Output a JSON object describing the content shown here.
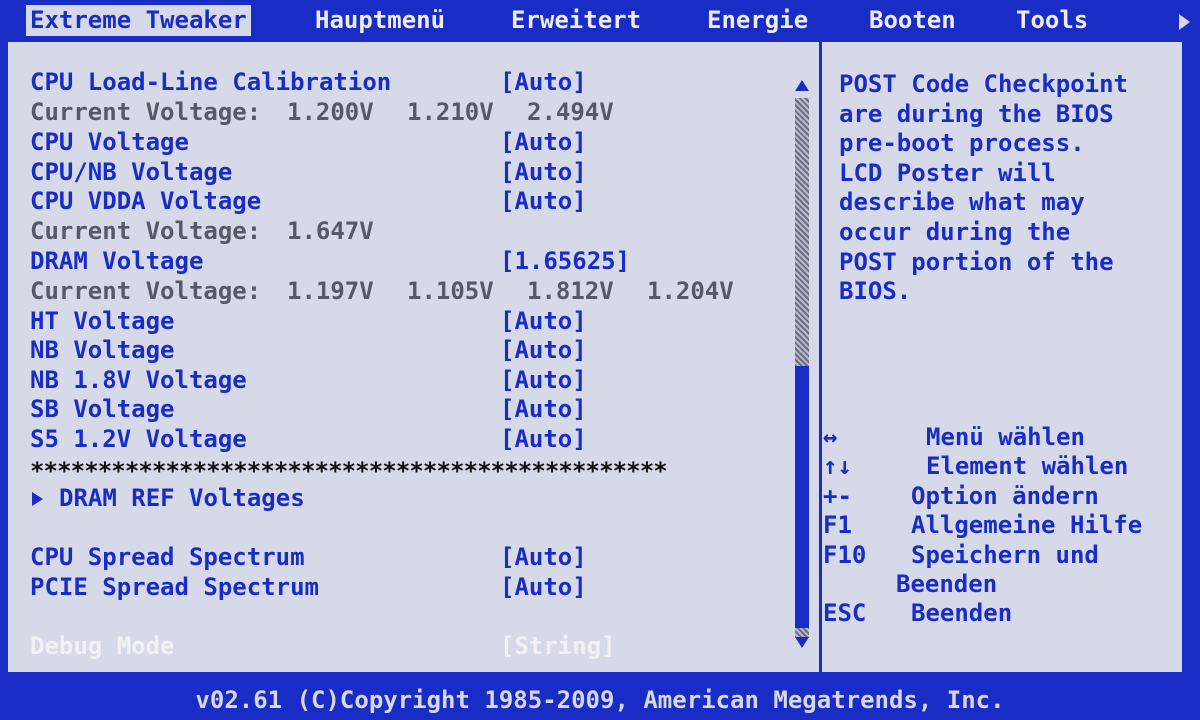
{
  "menu": {
    "tabs": [
      "Extreme Tweaker",
      "Hauptmenü",
      "Erweitert",
      "Energie",
      "Booten",
      "Tools"
    ]
  },
  "settings": [
    {
      "label": "CPU Load-Line Calibration",
      "value": "[Auto]"
    },
    {
      "label": "Current Voltage:",
      "readings": [
        "1.200V",
        "1.210V",
        "2.494V"
      ]
    },
    {
      "label": "CPU Voltage",
      "value": "[Auto]"
    },
    {
      "label": "CPU/NB Voltage",
      "value": "[Auto]"
    },
    {
      "label": "CPU VDDA Voltage",
      "value": "[Auto]"
    },
    {
      "label": "Current Voltage:",
      "readings": [
        "1.647V"
      ]
    },
    {
      "label": "DRAM Voltage",
      "value": "[1.65625]"
    },
    {
      "label": "Current Voltage:",
      "readings": [
        "1.197V",
        "1.105V",
        "1.812V",
        "1.204V"
      ]
    },
    {
      "label": "HT Voltage",
      "value": "[Auto]"
    },
    {
      "label": "NB Voltage",
      "value": "[Auto]"
    },
    {
      "label": "NB 1.8V Voltage",
      "value": "[Auto]"
    },
    {
      "label": "SB Voltage",
      "value": "[Auto]"
    },
    {
      "label": "S5 1.2V Voltage",
      "value": "[Auto]"
    }
  ],
  "separator": "***********************************************",
  "submenu": {
    "label": "DRAM REF Voltages"
  },
  "spread": [
    {
      "label": "CPU Spread Spectrum",
      "value": "[Auto]"
    },
    {
      "label": "PCIE Spread Spectrum",
      "value": "[Auto]"
    }
  ],
  "debug": {
    "label": "Debug Mode",
    "value": "[String]"
  },
  "help_lines": [
    "POST Code Checkpoint",
    "are during the BIOS",
    "pre-boot process.",
    "LCD Poster will",
    "describe what may",
    "occur during the",
    "POST portion of the",
    "BIOS."
  ],
  "keys": [
    {
      "key": "↔",
      "desc": "Menü wählen"
    },
    {
      "key": "↑↓",
      "desc": "Element wählen"
    },
    {
      "key": "+-",
      "desc": "Option ändern"
    },
    {
      "key": "F1",
      "desc": "Allgemeine Hilfe"
    },
    {
      "key": "F10",
      "desc": "Speichern und"
    },
    {
      "key": "",
      "desc": "Beenden"
    },
    {
      "key": "ESC",
      "desc": "Beenden"
    }
  ],
  "footer": "v02.61 (C)Copyright 1985-2009, American Megatrends, Inc.",
  "colors": {
    "bios_blue": "#1a2cc6",
    "panel_gray": "#d6d9e8",
    "info_gray": "#555a66",
    "disabled": "#f2f2f6"
  },
  "icons": [
    "scroll-up-icon",
    "scroll-down-icon",
    "submenu-arrow-icon",
    "menu-more-icon"
  ]
}
